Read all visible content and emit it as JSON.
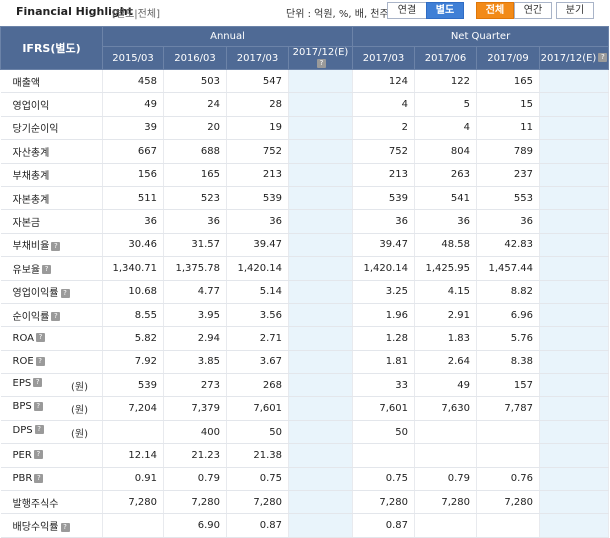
{
  "header": {
    "title": "Financial Highlight",
    "subtitle": "[별도|전체]",
    "unit_label": "단위 : 억원, %, 배, 천주",
    "consolidation_toggle": [
      "연결",
      "별도"
    ],
    "period_toggle": [
      "전체",
      "연간",
      "분기"
    ]
  },
  "table": {
    "corner_label": "IFRS(별도)",
    "group_labels": {
      "annual": "Annual",
      "quarter": "Net Quarter"
    },
    "periods": [
      "2015/03",
      "2016/03",
      "2017/03",
      "2017/12(E)",
      "2017/03",
      "2017/06",
      "2017/09",
      "2017/12(E)"
    ],
    "rows": [
      {
        "label": "매출액",
        "unit": "",
        "values": [
          "458",
          "503",
          "547",
          "",
          "124",
          "122",
          "165",
          ""
        ]
      },
      {
        "label": "영업이익",
        "unit": "",
        "values": [
          "49",
          "24",
          "28",
          "",
          "4",
          "5",
          "15",
          ""
        ]
      },
      {
        "label": "당기순이익",
        "unit": "",
        "values": [
          "39",
          "20",
          "19",
          "",
          "2",
          "4",
          "11",
          ""
        ]
      },
      {
        "label": "자산총계",
        "unit": "",
        "values": [
          "667",
          "688",
          "752",
          "",
          "752",
          "804",
          "789",
          ""
        ]
      },
      {
        "label": "부채총계",
        "unit": "",
        "values": [
          "156",
          "165",
          "213",
          "",
          "213",
          "263",
          "237",
          ""
        ]
      },
      {
        "label": "자본총계",
        "unit": "",
        "values": [
          "511",
          "523",
          "539",
          "",
          "539",
          "541",
          "553",
          ""
        ]
      },
      {
        "label": "자본금",
        "unit": "",
        "values": [
          "36",
          "36",
          "36",
          "",
          "36",
          "36",
          "36",
          ""
        ]
      },
      {
        "label": "부채비율",
        "unit": "",
        "values": [
          "30.46",
          "31.57",
          "39.47",
          "",
          "39.47",
          "48.58",
          "42.83",
          ""
        ]
      },
      {
        "label": "유보율",
        "unit": "",
        "values": [
          "1,340.71",
          "1,375.78",
          "1,420.14",
          "",
          "1,420.14",
          "1,425.95",
          "1,457.44",
          ""
        ]
      },
      {
        "label": "영업이익률",
        "unit": "",
        "values": [
          "10.68",
          "4.77",
          "5.14",
          "",
          "3.25",
          "4.15",
          "8.82",
          ""
        ]
      },
      {
        "label": "순이익률",
        "unit": "",
        "values": [
          "8.55",
          "3.95",
          "3.56",
          "",
          "1.96",
          "2.91",
          "6.96",
          ""
        ]
      },
      {
        "label": "ROA",
        "unit": "",
        "values": [
          "5.82",
          "2.94",
          "2.71",
          "",
          "1.28",
          "1.83",
          "5.76",
          ""
        ]
      },
      {
        "label": "ROE",
        "unit": "",
        "values": [
          "7.92",
          "3.85",
          "3.67",
          "",
          "1.81",
          "2.64",
          "8.38",
          ""
        ]
      },
      {
        "label": "EPS",
        "unit": "(원)",
        "values": [
          "539",
          "273",
          "268",
          "",
          "33",
          "49",
          "157",
          ""
        ]
      },
      {
        "label": "BPS",
        "unit": "(원)",
        "values": [
          "7,204",
          "7,379",
          "7,601",
          "",
          "7,601",
          "7,630",
          "7,787",
          ""
        ]
      },
      {
        "label": "DPS",
        "unit": "(원)",
        "values": [
          "",
          "400",
          "50",
          "",
          "50",
          "",
          "",
          ""
        ]
      },
      {
        "label": "PER",
        "unit": "",
        "values": [
          "12.14",
          "21.23",
          "21.38",
          "",
          "",
          "",
          "",
          ""
        ]
      },
      {
        "label": "PBR",
        "unit": "",
        "values": [
          "0.91",
          "0.79",
          "0.75",
          "",
          "0.75",
          "0.79",
          "0.76",
          ""
        ]
      },
      {
        "label": "발행주식수",
        "unit": "",
        "values": [
          "7,280",
          "7,280",
          "7,280",
          "",
          "7,280",
          "7,280",
          "7,280",
          ""
        ]
      },
      {
        "label": "배당수익률",
        "unit": "",
        "values": [
          "",
          "6.90",
          "0.87",
          "",
          "0.87",
          "",
          "",
          ""
        ]
      }
    ],
    "info_icon_rows": [
      7,
      8,
      9,
      10,
      11,
      12,
      13,
      14,
      15,
      16,
      17,
      19
    ],
    "info_icon_glyph": "?"
  },
  "colors": {
    "header_bg": "#4f6a95",
    "estimate_bg": "#e9f4fb",
    "active_blue": "#3f7fd6",
    "active_orange": "#f28a17"
  }
}
